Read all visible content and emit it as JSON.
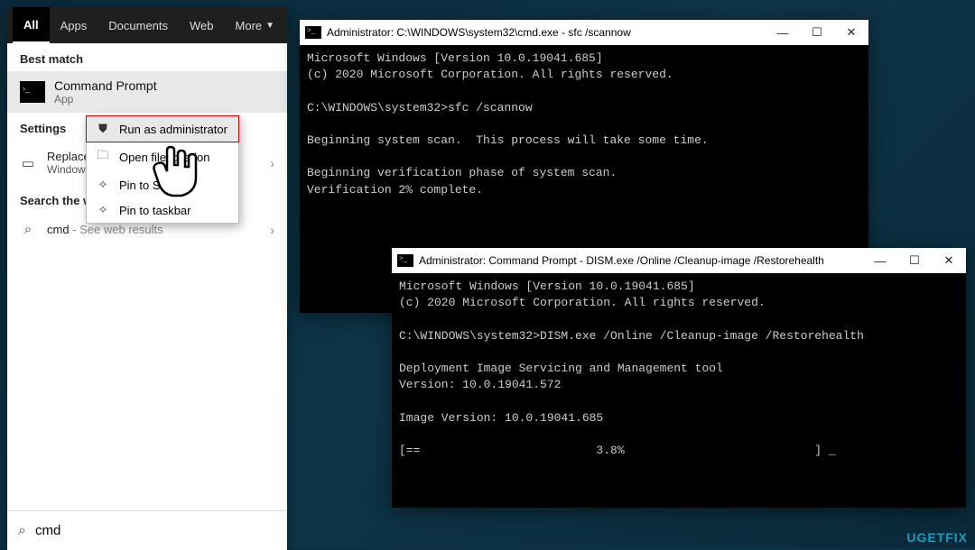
{
  "search": {
    "tabs": [
      "All",
      "Apps",
      "Documents",
      "Web",
      "More"
    ],
    "active_tab_index": 0,
    "sections": {
      "best_match_label": "Best match",
      "best_match": {
        "title": "Command Prompt",
        "subtitle": "App"
      },
      "settings_label": "Settings",
      "settings_item": {
        "label": "Replace",
        "sub": "Window"
      },
      "web_label": "Search the we",
      "web_item": {
        "label": "cmd",
        "hint": "See web results"
      }
    },
    "input_value": "cmd"
  },
  "context_menu": {
    "items": [
      {
        "icon": "shield-icon",
        "label": "Run as administrator",
        "highlight": true
      },
      {
        "icon": "folder-icon",
        "label": "Open file location",
        "highlight": false
      },
      {
        "icon": "pin-icon",
        "label": "Pin to Start",
        "highlight": false
      },
      {
        "icon": "pin-icon",
        "label": "Pin to taskbar",
        "highlight": false
      }
    ],
    "visible_call_char": "X"
  },
  "window1": {
    "title": "Administrator: C:\\WINDOWS\\system32\\cmd.exe - sfc  /scannow",
    "lines": [
      "Microsoft Windows [Version 10.0.19041.685]",
      "(c) 2020 Microsoft Corporation. All rights reserved.",
      "",
      "C:\\WINDOWS\\system32>sfc /scannow",
      "",
      "Beginning system scan.  This process will take some time.",
      "",
      "Beginning verification phase of system scan.",
      "Verification 2% complete."
    ]
  },
  "window2": {
    "title": "Administrator: Command Prompt - DISM.exe  /Online /Cleanup-image /Restorehealth",
    "lines": [
      "Microsoft Windows [Version 10.0.19041.685]",
      "(c) 2020 Microsoft Corporation. All rights reserved.",
      "",
      "C:\\WINDOWS\\system32>DISM.exe /Online /Cleanup-image /Restorehealth",
      "",
      "Deployment Image Servicing and Management tool",
      "Version: 10.0.19041.572",
      "",
      "Image Version: 10.0.19041.685",
      "",
      "[==                         3.8%                           ] _"
    ]
  },
  "watermark": "UGETFIX"
}
